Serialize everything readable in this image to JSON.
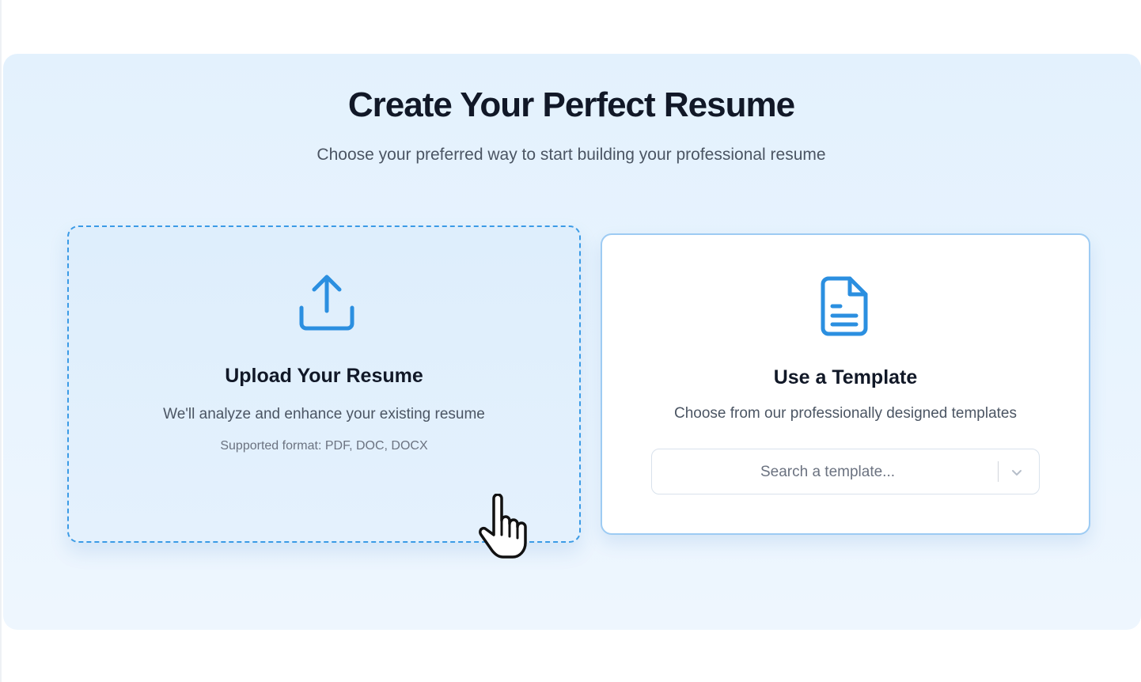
{
  "hero": {
    "title": "Create Your Perfect Resume",
    "subtitle": "Choose your preferred way to start building your professional resume"
  },
  "upload_card": {
    "icon": "upload-icon",
    "title": "Upload Your Resume",
    "description": "We'll analyze and enhance your existing resume",
    "formats": "Supported format: PDF, DOC, DOCX"
  },
  "template_card": {
    "icon": "document-icon",
    "title": "Use a Template",
    "description": "Choose from our professionally designed templates",
    "search_placeholder": "Search a template...",
    "dropdown_icon": "chevron-down-icon"
  },
  "colors": {
    "accent": "#2b8fe0",
    "text_dark": "#111827",
    "text_muted": "#4b5563",
    "hero_bg": "#e6f2fd"
  },
  "cursor": "hand-pointer-cursor"
}
